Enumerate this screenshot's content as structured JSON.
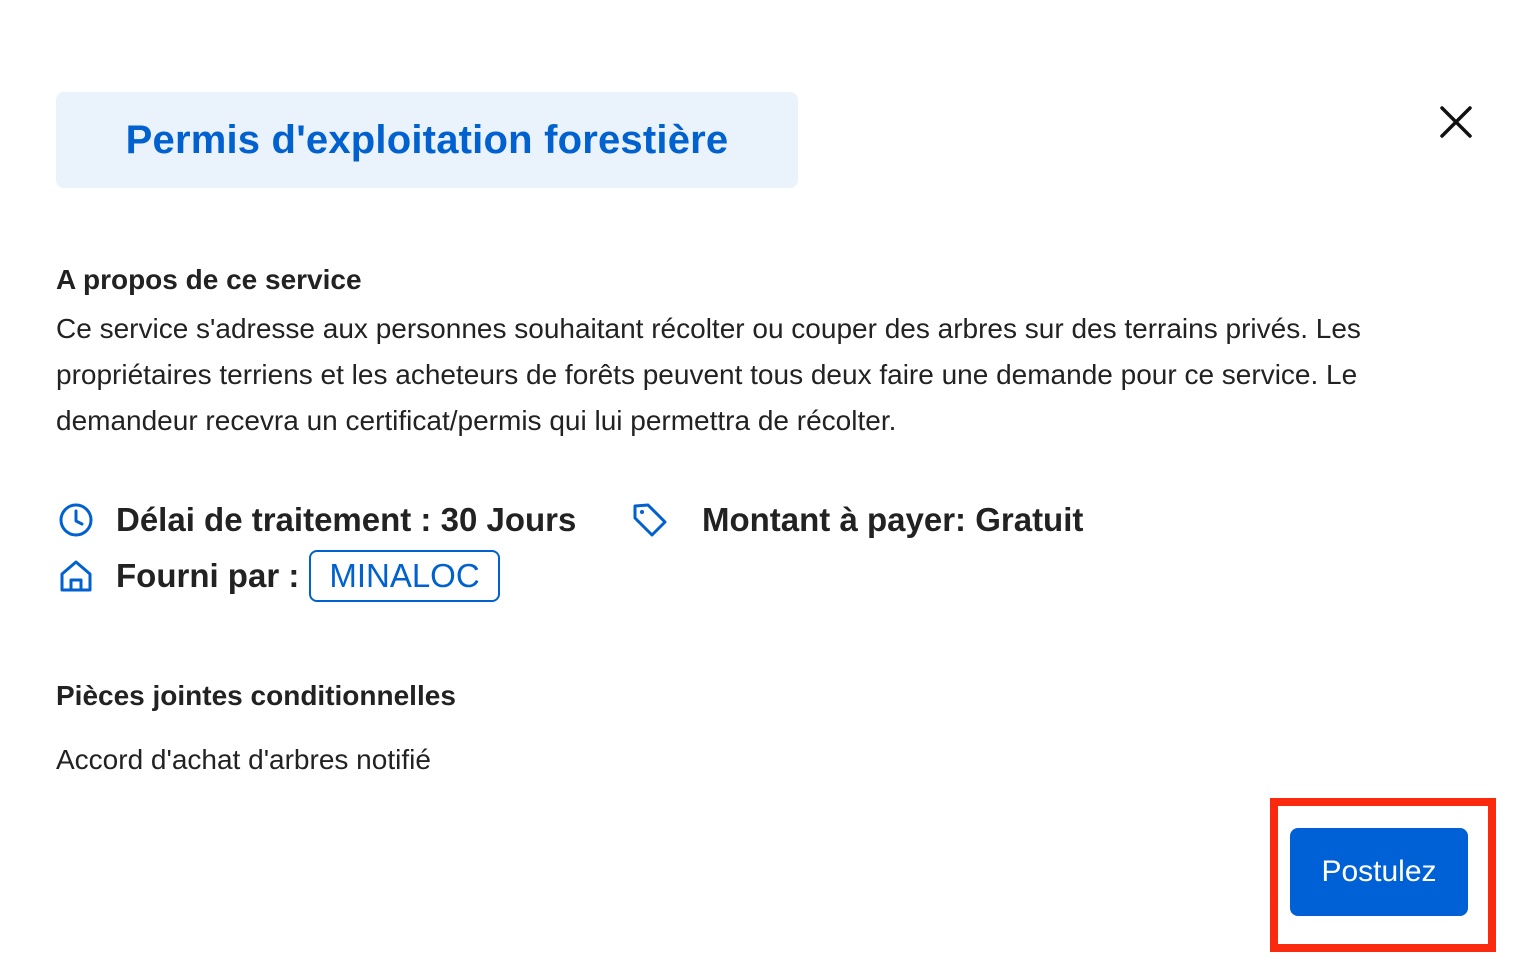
{
  "modal": {
    "title": "Permis d'exploitation forestière",
    "close_icon": "close-icon"
  },
  "about": {
    "heading": "A propos de ce service",
    "description": "Ce service s'adresse aux personnes souhaitant récolter ou couper des arbres sur des terrains privés. Les propriétaires terriens et les acheteurs de forêts peuvent tous deux faire une demande pour ce service. Le demandeur recevra un certificat/permis qui lui permettra de récolter."
  },
  "meta": {
    "processing_time": "Délai de traitement : 30 Jours",
    "amount": "Montant à payer: Gratuit",
    "provided_by_label": "Fourni par :",
    "provider": "MINALOC",
    "icons": {
      "processing_time": "clock-icon",
      "amount": "tag-icon",
      "provider": "home-icon"
    }
  },
  "attachments": {
    "heading": "Pièces jointes conditionnelles",
    "items": [
      "Accord d'achat d'arbres notifié"
    ]
  },
  "actions": {
    "apply_label": "Postulez"
  },
  "colors": {
    "accent": "#0061cf",
    "title_background": "#eaf2fc",
    "button": "#0061d6",
    "highlight": "#fb2a0f"
  }
}
